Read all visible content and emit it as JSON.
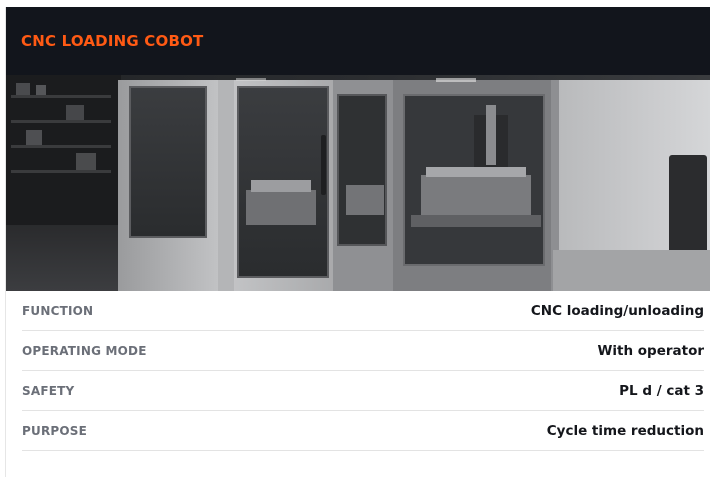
{
  "card": {
    "title": "CNC LOADING COBOT",
    "title_color": "#ff5a14",
    "header_bg": "#12151c",
    "image": "cnc-machining-center-photo"
  },
  "specs": [
    {
      "label": "FUNCTION",
      "value": "CNC loading/unloading"
    },
    {
      "label": "OPERATING MODE",
      "value": "With operator"
    },
    {
      "label": "SAFETY",
      "value": "PL d / cat 3"
    },
    {
      "label": "PURPOSE",
      "value": "Cycle time reduction"
    }
  ]
}
